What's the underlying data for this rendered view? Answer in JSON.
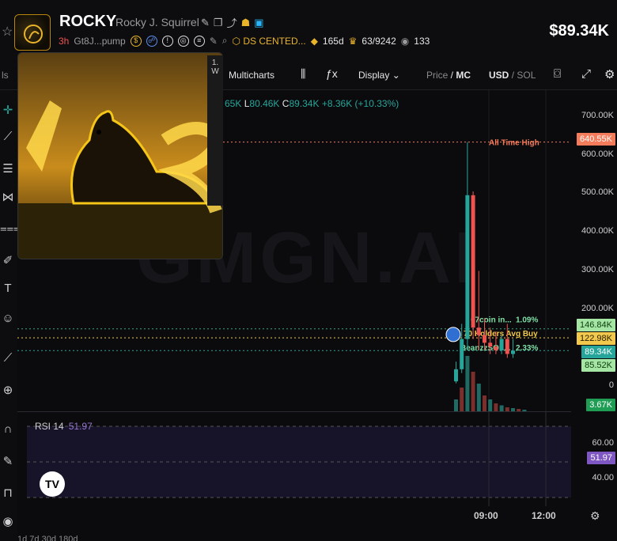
{
  "header": {
    "ticker": "ROCKY",
    "full_name": "Rocky J. Squirrel",
    "age": "3h",
    "address": "Gt8J...pump",
    "dev_tag": "DS CENTED...",
    "holders_age": "165d",
    "holders_ratio": "63/9242",
    "watchers": "133",
    "price": "$89.34K"
  },
  "toolbar": {
    "left_fragment": "ls",
    "multicharts": "Multicharts",
    "display": "Display",
    "price_label": "Price",
    "mc_label": "MC",
    "usd_label": "USD",
    "sol_label": "SOL"
  },
  "ohlc": {
    "h": "65K",
    "l_label": "L",
    "l": "80.46K",
    "c_label": "C",
    "c": "89.34K",
    "change": "+8.36K (+10.33%)"
  },
  "watermark": "GMGN.AI",
  "chart_data": {
    "type": "candlestick",
    "title": "",
    "y_ticks": [
      "700.00K",
      "600.00K",
      "500.00K",
      "400.00K",
      "300.00K",
      "200.00K",
      "0"
    ],
    "x_ticks": [
      "09:00",
      "12:00"
    ],
    "ylim": [
      0,
      740000
    ],
    "annotations": {
      "ath_label": "All Time High",
      "ath_value": "640.55K",
      "avg_buy_label": "70 Holders Avg Buy",
      "avg_buy_value": "122.98K",
      "trader1_label": "67coin in...",
      "trader1_pct": "1.09%",
      "trader1_value": "146.84K",
      "trader2_label": "BeanzzSOL...",
      "trader2_pct": "2.33%",
      "trader2_value": "85.52K",
      "last_price": "89.34K",
      "volume": "3.67K"
    },
    "candles": [
      {
        "o": 8000,
        "h": 60000,
        "l": 3000,
        "c": 40000
      },
      {
        "o": 40000,
        "h": 160000,
        "l": 30000,
        "c": 120000
      },
      {
        "o": 120000,
        "h": 640550,
        "l": 90000,
        "c": 500000
      },
      {
        "o": 500000,
        "h": 510000,
        "l": 120000,
        "c": 150000
      },
      {
        "o": 150000,
        "h": 300000,
        "l": 90000,
        "c": 130000
      },
      {
        "o": 130000,
        "h": 175000,
        "l": 90000,
        "c": 110000
      },
      {
        "o": 110000,
        "h": 150000,
        "l": 80000,
        "c": 100000
      },
      {
        "o": 100000,
        "h": 140000,
        "l": 80000,
        "c": 90000
      },
      {
        "o": 90000,
        "h": 130000,
        "l": 80000,
        "c": 120000
      },
      {
        "o": 120000,
        "h": 160000,
        "l": 70000,
        "c": 80460
      },
      {
        "o": 80460,
        "h": 120000,
        "l": 70000,
        "c": 89340
      }
    ],
    "volumes": [
      30,
      60,
      140,
      100,
      70,
      40,
      30,
      20,
      15,
      10,
      8,
      6,
      4
    ]
  },
  "rsi": {
    "label": "RSI",
    "period": "14",
    "value": "51.97",
    "ticks": [
      "60.00",
      "40.00"
    ]
  },
  "timeaxis": {
    "bottom": "1d   7d   30d   180d"
  },
  "colors": {
    "up": "#26a69a",
    "down": "#ef5350",
    "ath": "#f57c5b",
    "avg": "#f2c94c",
    "rsi": "#7e57c2"
  }
}
